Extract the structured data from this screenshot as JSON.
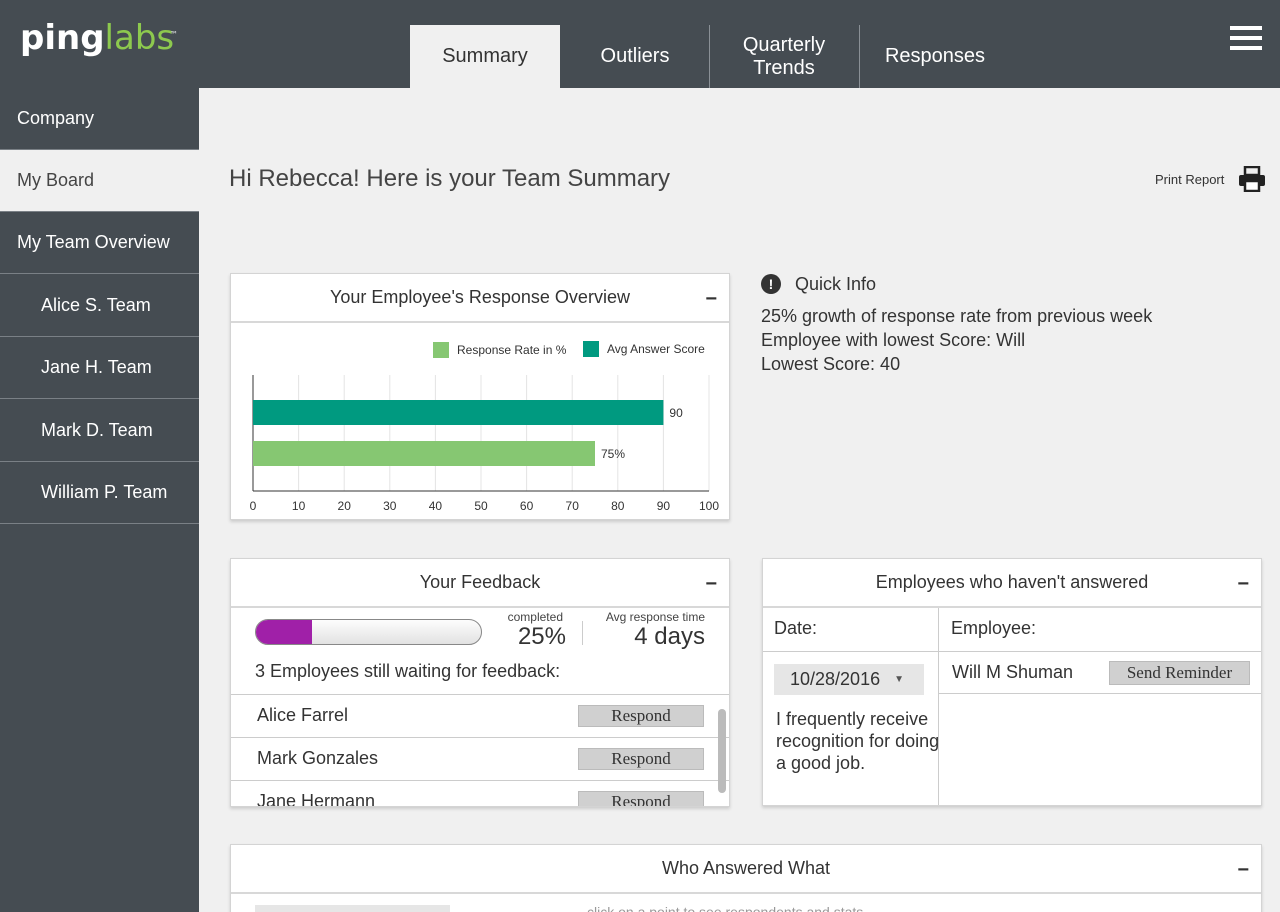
{
  "app": {
    "logo_main": "ping",
    "logo_accent": "labs",
    "logo_tm": "™"
  },
  "tabs": [
    {
      "label": "Summary",
      "active": true
    },
    {
      "label": "Outliers",
      "active": false
    },
    {
      "label": "Quarterly Trends",
      "active": false
    },
    {
      "label": "Responses",
      "active": false
    }
  ],
  "sidebar": {
    "items": [
      {
        "label": "Company"
      },
      {
        "label": "My Board",
        "active": true
      },
      {
        "label": "My Team Overview"
      },
      {
        "label": "Alice S. Team"
      },
      {
        "label": "Jane H. Team"
      },
      {
        "label": "Mark D. Team"
      },
      {
        "label": "William P. Team"
      }
    ]
  },
  "main": {
    "greeting": "Hi Rebecca! Here is your Team Summary",
    "print_label": "Print Report"
  },
  "overview_card": {
    "title": "Your Employee's Response Overview",
    "minimize": "−"
  },
  "chart_data": {
    "type": "bar",
    "orientation": "horizontal",
    "series": [
      {
        "name": "Avg Answer Score",
        "value": 90,
        "label": "90",
        "color": "#009a80"
      },
      {
        "name": "Response Rate in %",
        "value": 75,
        "label": "75%",
        "color": "#86c772"
      }
    ],
    "legend": [
      "Response Rate in %",
      "Avg Answer Score"
    ],
    "legend_colors": [
      "#86c772",
      "#009a80"
    ],
    "xlim": [
      0,
      100
    ],
    "xticks": [
      0,
      10,
      20,
      30,
      40,
      50,
      60,
      70,
      80,
      90,
      100
    ],
    "grid": true,
    "legend_position": "top-right"
  },
  "quick_info": {
    "title": "Quick Info",
    "icon": "!",
    "lines": [
      "25% growth of response rate from previous week",
      "Employee with lowest Score: Will",
      "Lowest Score: 40"
    ]
  },
  "feedback_card": {
    "title": "Your Feedback",
    "minimize": "−",
    "progress": 0.25,
    "progress_color": "#a020a8",
    "completed_label": "completed",
    "completed_value": "25%",
    "avg_label": "Avg response time",
    "avg_value": "4 days",
    "waiting_text": "3 Employees still waiting for feedback:",
    "respond_label": "Respond",
    "employees": [
      "Alice Farrel",
      "Mark Gonzales",
      "Jane Hermann"
    ]
  },
  "not_answered_card": {
    "title": "Employees who haven't answered",
    "minimize": "−",
    "date_header": "Date:",
    "employee_header": "Employee:",
    "date_value": "10/28/2016",
    "question": "I frequently receive recognition for doing a good job.",
    "employee": "Will M Shuman",
    "reminder_label": "Send Reminder"
  },
  "who_answered_card": {
    "title": "Who Answered What",
    "minimize": "−",
    "hint": "click on a point to see respondents and stats"
  }
}
